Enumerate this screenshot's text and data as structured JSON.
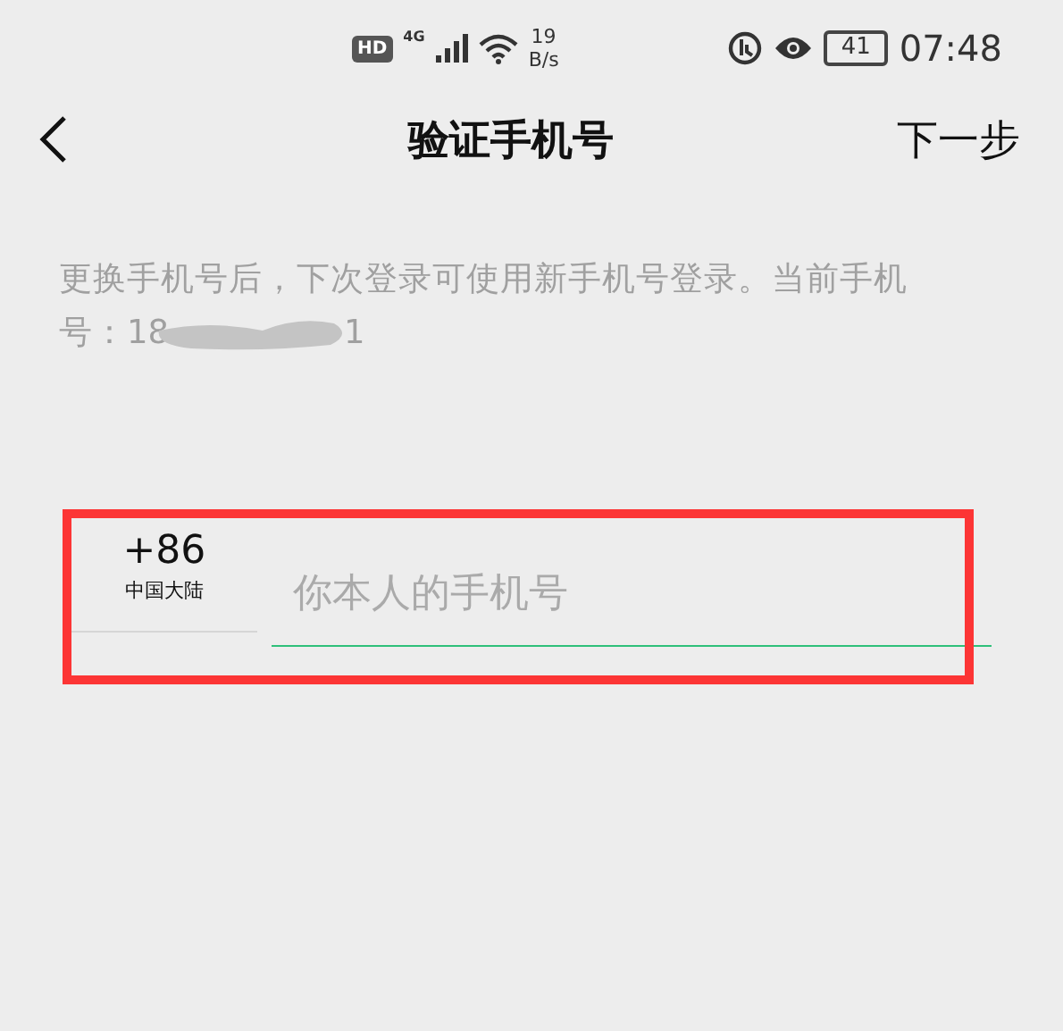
{
  "status_bar": {
    "hd": "HD",
    "network": "4G",
    "speed_value": "19",
    "speed_unit": "B/s",
    "battery": "41",
    "time": "07:48"
  },
  "nav": {
    "title": "验证手机号",
    "action": "下一步"
  },
  "note": {
    "lines": [
      "更换手机号后，下次登录可使用新手机号登录。当前手机",
      "号：18"
    ],
    "tail": "1"
  },
  "phone": {
    "code": "+86",
    "region": "中国大陆",
    "placeholder": "你本人的手机号"
  }
}
